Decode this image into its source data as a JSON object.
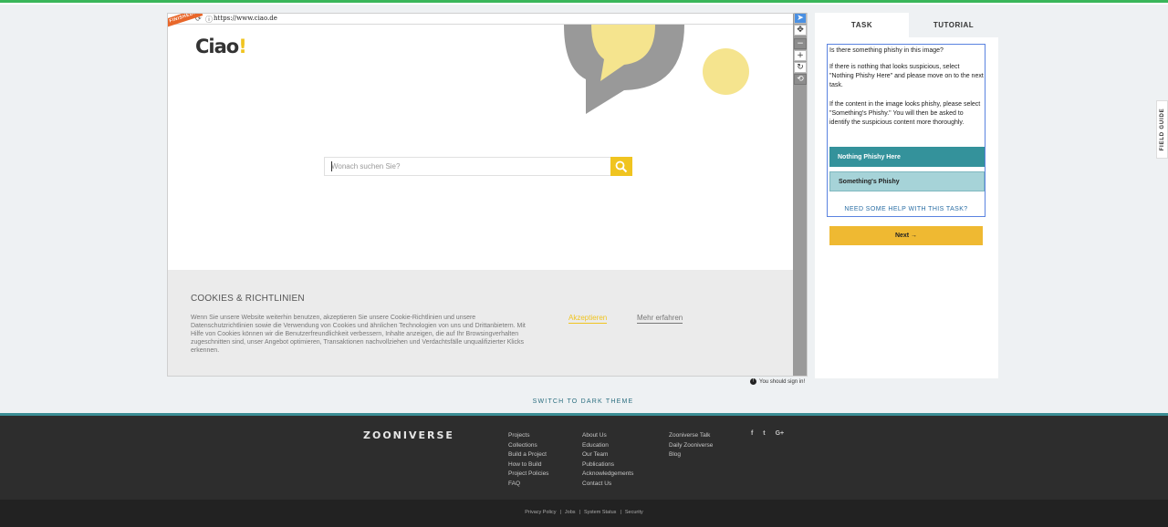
{
  "viewer": {
    "badge": "FINISHED!",
    "url": "https://www.ciao.de",
    "logo_text": "Ciao",
    "logo_bang": "!",
    "search_placeholder": "Wonach suchen Sie?",
    "cookies": {
      "title": "COOKIES & RICHTLINIEN",
      "text": "Wenn Sie unsere Website weiterhin benutzen, akzeptieren Sie unsere Cookie-Richtlinien und unsere Datenschutzrichtlinien sowie die Verwendung von Cookies und ähnlichen Technologien von uns und Drittanbietern. Mit Hilfe von Cookies können wir die Benutzerfreundlichkeit verbessern, Inhalte anzeigen, die auf Ihr Browsingverhalten zugeschnitten sind, unser Angebot optimieren, Transaktionen nachvollziehen und Verdachtsfälle unqualifizierter Klicks erkennen.",
      "accept": "Akzeptieren",
      "more": "Mehr erfahren"
    },
    "colors": {
      "brand_yellow": "#f0c420",
      "bubble_gray": "#999999",
      "bubble_yellow": "#f5e48e"
    }
  },
  "tools": [
    "pointer-icon",
    "move-icon",
    "zoom-out-icon",
    "zoom-in-icon",
    "rotate-icon",
    "reset-icon"
  ],
  "signin_notice": "You should sign in!",
  "panel": {
    "tabs": {
      "task": "TASK",
      "tutorial": "TUTORIAL"
    },
    "question": "Is there something phishy in this image?",
    "para1": "If there is nothing that looks suspicious, select \"Nothing Phishy Here\" and please move on to the next task.",
    "para2": "If the content in the image looks phishy, please select \"Something's Phishy.\" You will then be asked to identify the suspicious content more thoroughly.",
    "answers": [
      "Nothing Phishy Here",
      "Something's Phishy"
    ],
    "help": "NEED SOME HELP WITH THIS TASK?",
    "next": "Next →"
  },
  "field_guide": "FIELD GUIDE",
  "dark_theme": "SWITCH TO DARK THEME",
  "footer": {
    "brand": "ZOONIVERSE",
    "col1": [
      "Projects",
      "Collections",
      "Build a Project",
      "How to Build",
      "Project Policies",
      "FAQ"
    ],
    "col2": [
      "About Us",
      "Education",
      "Our Team",
      "Publications",
      "Acknowledgements",
      "Contact Us"
    ],
    "col3": [
      "Zooniverse Talk",
      "Daily Zooniverse",
      "Blog"
    ],
    "social": [
      "f",
      "t",
      "G+"
    ],
    "legal": [
      "Privacy Policy",
      "Jobs",
      "System Status",
      "Security"
    ]
  }
}
